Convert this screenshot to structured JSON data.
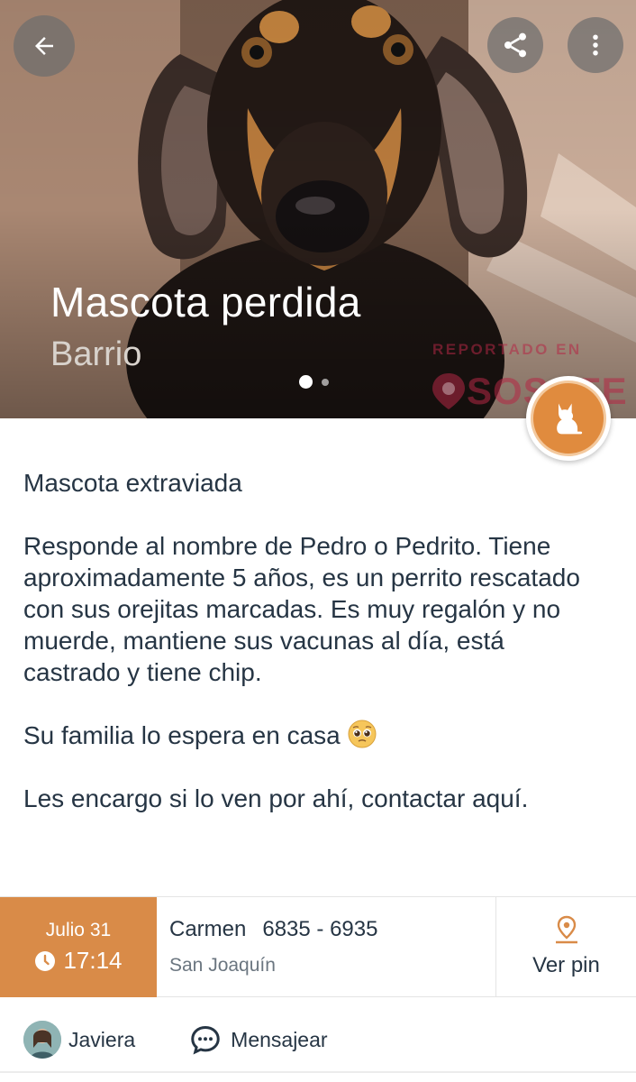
{
  "hero": {
    "title": "Mascota perdida",
    "subtitle": "Barrio",
    "watermark_top": "REPORTADO EN",
    "watermark_logo": "SOSAFE",
    "image_count": 2,
    "active_image": 1,
    "back_icon": "arrow-left-icon",
    "share_icon": "share-icon",
    "more_icon": "more-vertical-icon",
    "fab_icon": "cat-icon"
  },
  "post": {
    "heading": "Mascota extraviada",
    "paragraph_1": "Responde al nombre de Pedro o Pedrito. Tiene aproximadamente 5 años, es un perrito rescatado con sus orejitas marcadas. Es muy regalón y no muerde, mantiene sus vacunas al día, está castrado y tiene chip.",
    "paragraph_2": "Su familia lo espera en casa",
    "paragraph_3": "Les encargo si lo ven por ahí, contactar aquí."
  },
  "info": {
    "date": "Julio 31",
    "time": "17:14",
    "contact_name": "Carmen",
    "contact_phone": "6835 - 6935",
    "area": "San Joaquín",
    "pin_label": "Ver pin",
    "accent_color": "#d98b48"
  },
  "footer": {
    "user_name": "Javiera",
    "message_label": "Mensajear"
  }
}
